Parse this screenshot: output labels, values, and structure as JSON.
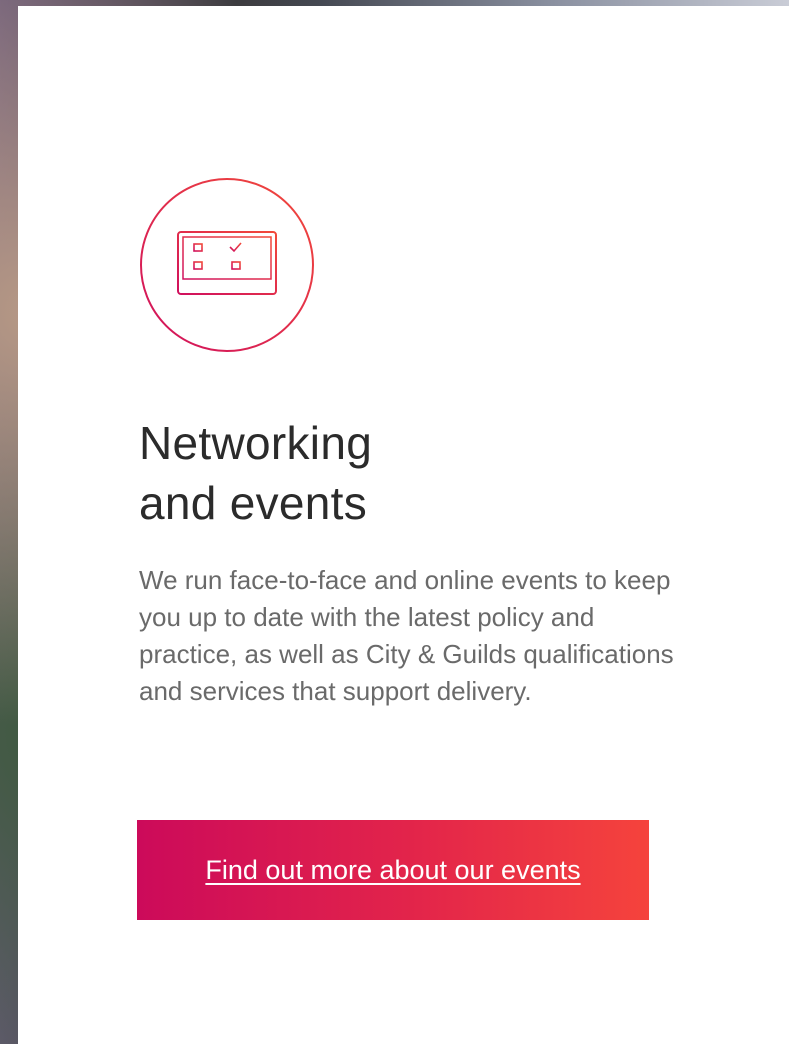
{
  "card": {
    "icon": "computer-checklist-icon",
    "heading_line1": "Networking",
    "heading_line2": "and events",
    "description": "We run face-to-face and online events to keep you up to date with the latest policy and practice, as well as City & Guilds qualifications and services that support delivery.",
    "cta_label": "Find out more about our events"
  },
  "colors": {
    "accent_start": "#cc0a5a",
    "accent_end": "#f5433c",
    "heading": "#2b2b2b",
    "body_text": "#6a6a6a"
  }
}
